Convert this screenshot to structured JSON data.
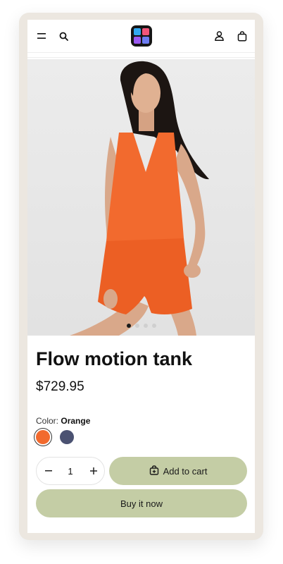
{
  "product": {
    "title": "Flow motion tank",
    "price": "$729.95",
    "color_label": "Color:",
    "color_value": "Orange",
    "swatches": [
      {
        "name": "Orange",
        "color": "#f26a2e"
      },
      {
        "name": "Navy",
        "color": "#4b5272"
      }
    ],
    "quantity": "1",
    "gallery": {
      "count": 4,
      "active": 1
    },
    "image_alt": "Woman wearing orange tank top and orange shorts"
  },
  "actions": {
    "add_to_cart": "Add to cart",
    "buy_now": "Buy it now"
  },
  "colors": {
    "accent": "#c4cda5",
    "logo_bg": "#161616"
  }
}
